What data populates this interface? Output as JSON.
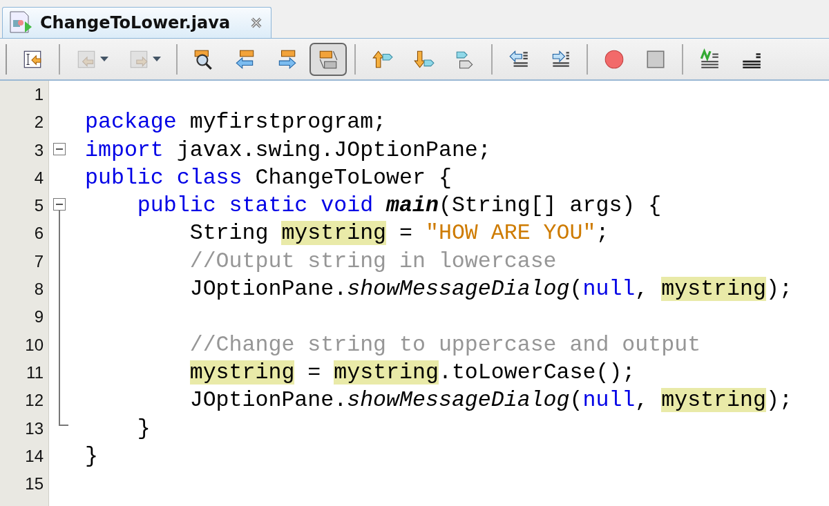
{
  "tab": {
    "title": "ChangeToLower.java",
    "selected": true
  },
  "toolbar": [
    {
      "kind": "button",
      "disabled": false,
      "pressed": false,
      "dropdown": false
    },
    {
      "kind": "separator"
    },
    {
      "kind": "button",
      "disabled": true,
      "pressed": false,
      "dropdown": true
    },
    {
      "kind": "button",
      "disabled": true,
      "pressed": false,
      "dropdown": true
    },
    {
      "kind": "separator"
    },
    {
      "kind": "button",
      "disabled": false,
      "pressed": false,
      "dropdown": false
    },
    {
      "kind": "button",
      "disabled": false,
      "pressed": false,
      "dropdown": false
    },
    {
      "kind": "button",
      "disabled": false,
      "pressed": false,
      "dropdown": false
    },
    {
      "kind": "button",
      "disabled": false,
      "pressed": true,
      "dropdown": false
    },
    {
      "kind": "separator"
    },
    {
      "kind": "button",
      "disabled": false,
      "pressed": false,
      "dropdown": false
    },
    {
      "kind": "button",
      "disabled": false,
      "pressed": false,
      "dropdown": false
    },
    {
      "kind": "button",
      "disabled": false,
      "pressed": false,
      "dropdown": false
    },
    {
      "kind": "separator"
    },
    {
      "kind": "button",
      "disabled": false,
      "pressed": false,
      "dropdown": false
    },
    {
      "kind": "button",
      "disabled": false,
      "pressed": false,
      "dropdown": false
    },
    {
      "kind": "separator"
    },
    {
      "kind": "button",
      "disabled": false,
      "pressed": false,
      "dropdown": false
    },
    {
      "kind": "button",
      "disabled": false,
      "pressed": false,
      "dropdown": false
    },
    {
      "kind": "separator"
    },
    {
      "kind": "button",
      "disabled": false,
      "pressed": false,
      "dropdown": false
    },
    {
      "kind": "button",
      "disabled": false,
      "pressed": false,
      "dropdown": false
    }
  ],
  "lines": [
    {
      "number": "1",
      "kind": "plain"
    },
    {
      "number": "2",
      "kind": "plain",
      "tokens": [
        {
          "kind": "keyword",
          "text": "package"
        },
        {
          "kind": "plain",
          "text": " myfirstprogram;"
        }
      ]
    },
    {
      "number": "3",
      "kind": "fold-start",
      "tokens": [
        {
          "kind": "keyword",
          "text": "import"
        },
        {
          "kind": "plain",
          "text": " javax.swing.JOptionPane;"
        }
      ]
    },
    {
      "number": "4",
      "kind": "plain",
      "tokens": [
        {
          "kind": "keyword",
          "text": "public class"
        },
        {
          "kind": "plain",
          "text": " ChangeToLower {"
        }
      ]
    },
    {
      "number": "5",
      "kind": "fold-start",
      "tokens": [
        {
          "kind": "keyword",
          "text": "    public static void "
        },
        {
          "kind": "declaration",
          "text": "main"
        },
        {
          "kind": "plain",
          "text": "(String[] args) {"
        }
      ]
    },
    {
      "number": "6",
      "kind": "fold-body",
      "tokens": [
        {
          "kind": "plain",
          "text": "        String "
        },
        {
          "kind": "mark",
          "text": "mystring"
        },
        {
          "kind": "plain",
          "text": " = "
        },
        {
          "kind": "string",
          "text": "\"HOW ARE YOU\""
        },
        {
          "kind": "plain",
          "text": ";"
        }
      ]
    },
    {
      "number": "7",
      "kind": "fold-body",
      "tokens": [
        {
          "kind": "comment",
          "text": "        //Output string in lowercase"
        }
      ]
    },
    {
      "number": "8",
      "kind": "fold-body",
      "tokens": [
        {
          "kind": "plain",
          "text": "        JOptionPane."
        },
        {
          "kind": "method",
          "text": "showMessageDialog"
        },
        {
          "kind": "plain",
          "text": "("
        },
        {
          "kind": "keyword",
          "text": "null"
        },
        {
          "kind": "plain",
          "text": ", "
        },
        {
          "kind": "mark",
          "text": "mystring"
        },
        {
          "kind": "plain",
          "text": ");"
        }
      ]
    },
    {
      "number": "9",
      "kind": "fold-body"
    },
    {
      "number": "10",
      "kind": "fold-body",
      "tokens": [
        {
          "kind": "comment",
          "text": "        //Change string to uppercase and output"
        }
      ]
    },
    {
      "number": "11",
      "kind": "fold-body",
      "tokens": [
        {
          "kind": "mark",
          "text": "        mystring"
        },
        {
          "kind": "plain",
          "text": " = "
        },
        {
          "kind": "mark",
          "text": "mystring"
        },
        {
          "kind": "plain",
          "text": ".toLowerCase();"
        }
      ]
    },
    {
      "number": "12",
      "kind": "fold-body",
      "tokens": [
        {
          "kind": "plain",
          "text": "        JOptionPane."
        },
        {
          "kind": "method",
          "text": "showMessageDialog"
        },
        {
          "kind": "plain",
          "text": "("
        },
        {
          "kind": "keyword",
          "text": "null"
        },
        {
          "kind": "plain",
          "text": ", "
        },
        {
          "kind": "mark",
          "text": "mystring"
        },
        {
          "kind": "plain",
          "text": ");"
        }
      ]
    },
    {
      "number": "13",
      "kind": "fold-end",
      "tokens": [
        {
          "kind": "plain",
          "text": "    }"
        }
      ]
    },
    {
      "number": "14",
      "kind": "plain",
      "tokens": [
        {
          "kind": "plain",
          "text": "}"
        }
      ]
    },
    {
      "number": "15",
      "kind": "plain"
    }
  ]
}
